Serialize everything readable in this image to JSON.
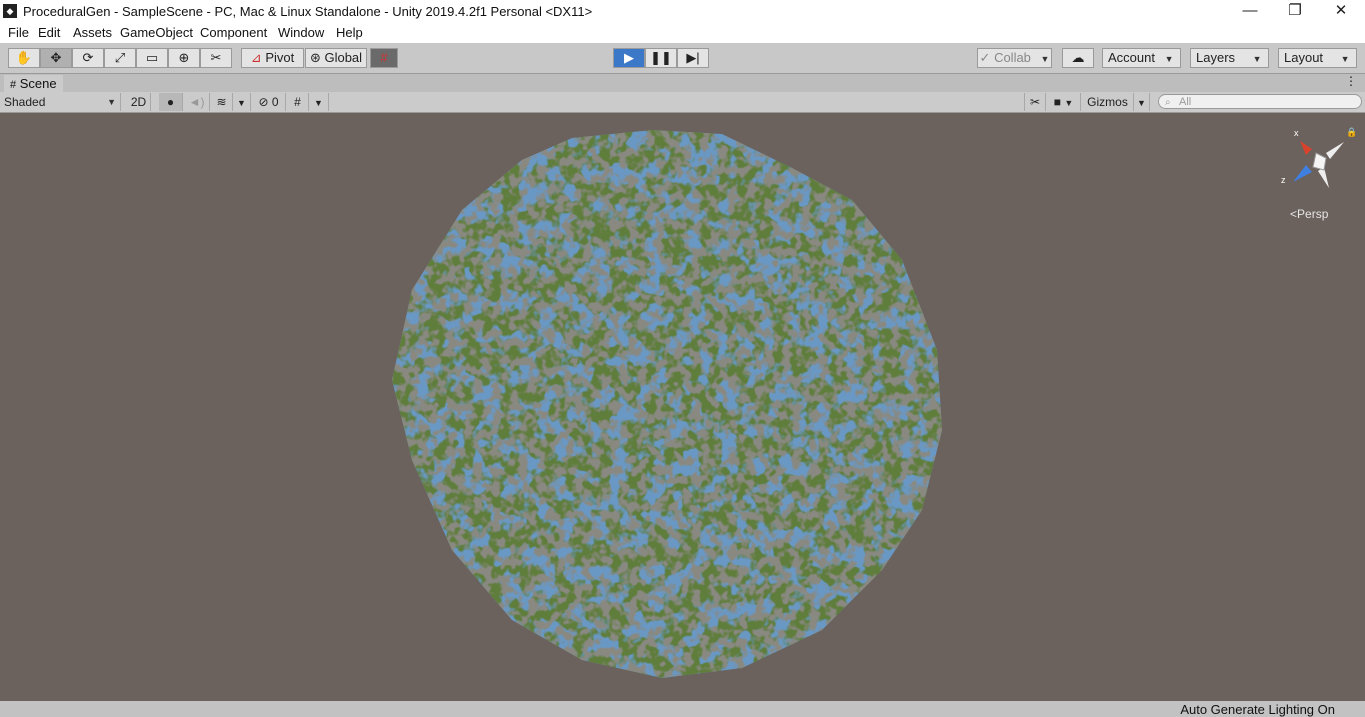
{
  "window": {
    "title": "ProceduralGen - SampleScene - PC, Mac & Linux Standalone - Unity 2019.4.2f1 Personal <DX11>",
    "app_icon": "unity-icon",
    "minimize_glyph": "—",
    "maximize_glyph": "❐",
    "close_glyph": "✕"
  },
  "menu": [
    "File",
    "Edit",
    "Assets",
    "GameObject",
    "Component",
    "Window",
    "Help"
  ],
  "toolbar": {
    "tools": [
      "hand-tool-icon",
      "move-tool-icon",
      "rotate-tool-icon",
      "scale-tool-icon",
      "rect-tool-icon",
      "transform-tool-icon",
      "custom-tool-icon"
    ],
    "pivot_label": "Pivot",
    "global_label": "Global",
    "collab_label": "Collab",
    "account_label": "Account",
    "layers_label": "Layers",
    "layout_label": "Layout",
    "play_state": "playing"
  },
  "scene_tab": {
    "label": "Scene"
  },
  "scene_toolbar": {
    "shading_mode": "Shaded",
    "mode_2d": "2D",
    "hidden_count": "0",
    "gizmos_label": "Gizmos",
    "search_placeholder": "All"
  },
  "viewport": {
    "background_color": "#6b625d",
    "projection_label": "Persp",
    "axis_x": "x",
    "axis_z": "z",
    "terrain_land_color": "#5e7d3a",
    "terrain_water_color": "#6a98c4"
  },
  "status": {
    "text": "Auto Generate Lighting On"
  },
  "colors": {
    "play_active": "#3c78c8"
  }
}
